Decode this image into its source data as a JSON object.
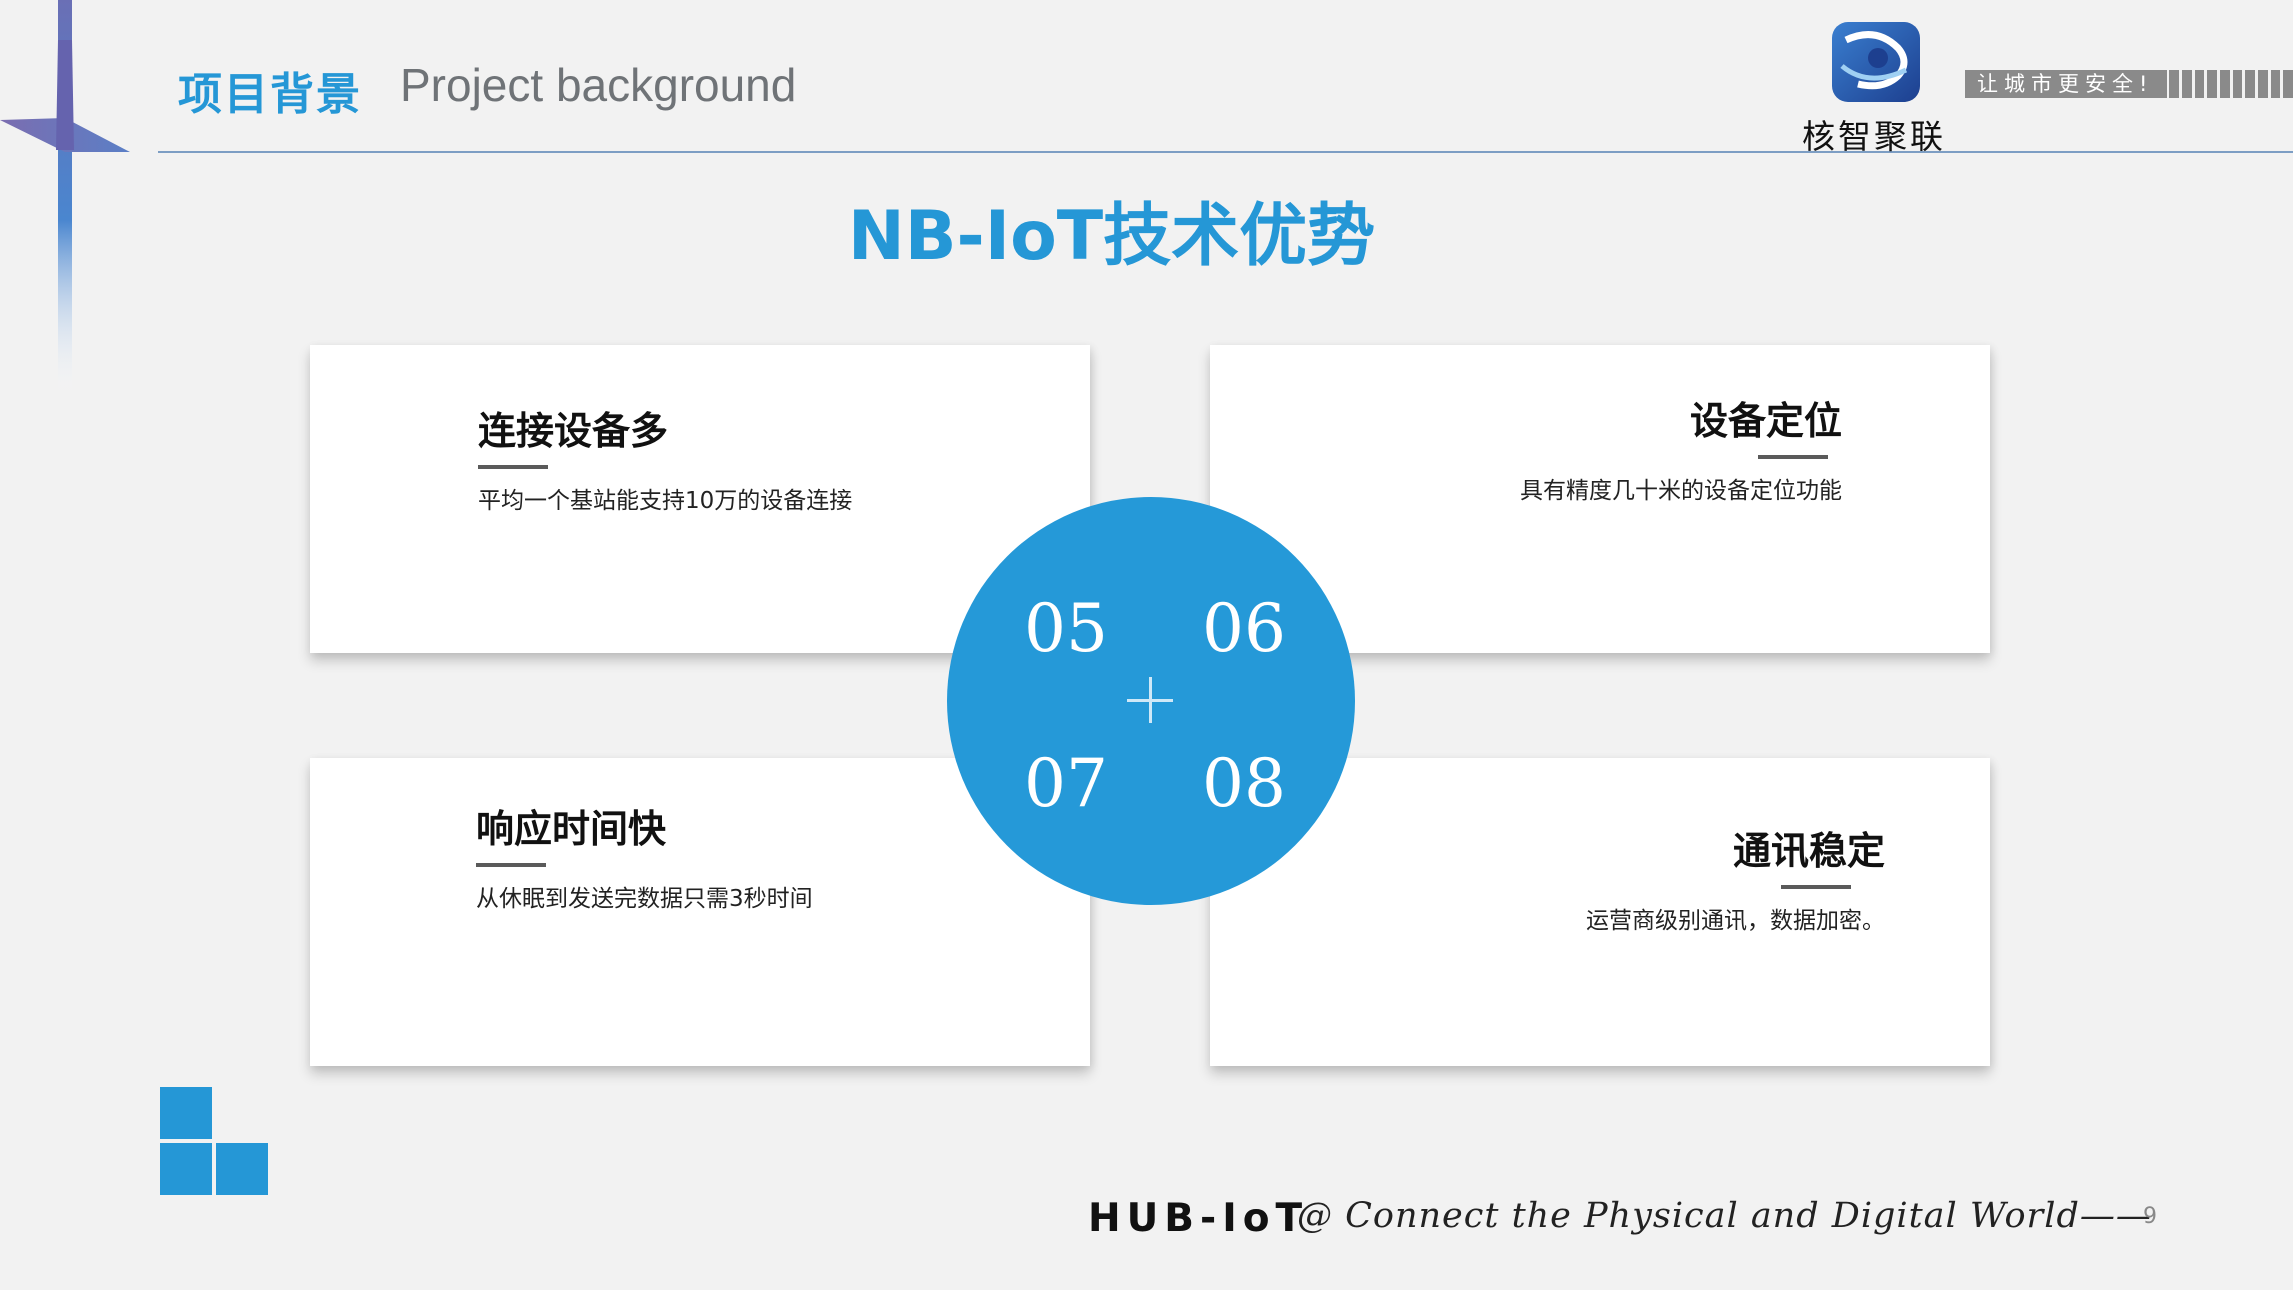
{
  "header": {
    "title_cn": "项目背景",
    "title_en": "Project background"
  },
  "logo": {
    "name": "核智聚联",
    "slogan": "让城市更安全!"
  },
  "main_title": "NB-IoT技术优势",
  "cards": [
    {
      "title": "连接设备多",
      "desc": "平均一个基站能支持10万的设备连接"
    },
    {
      "title": "设备定位",
      "desc": "具有精度几十米的设备定位功能"
    },
    {
      "title": "响应时间快",
      "desc": "从休眠到发送完数据只需3秒时间"
    },
    {
      "title": "通讯稳定",
      "desc": "运营商级别通讯，数据加密。"
    }
  ],
  "circle": {
    "numbers": [
      "05",
      "06",
      "07",
      "08"
    ],
    "center_symbol": "plus-icon"
  },
  "footer": {
    "brand": "HUB-IoT",
    "tagline": "@ Connect the Physical and Digital World——",
    "page_number": "9"
  },
  "colors": {
    "accent": "#2597d6",
    "background": "#f2f2f2",
    "card": "#ffffff",
    "slogan_bg": "#8a8a8a"
  }
}
